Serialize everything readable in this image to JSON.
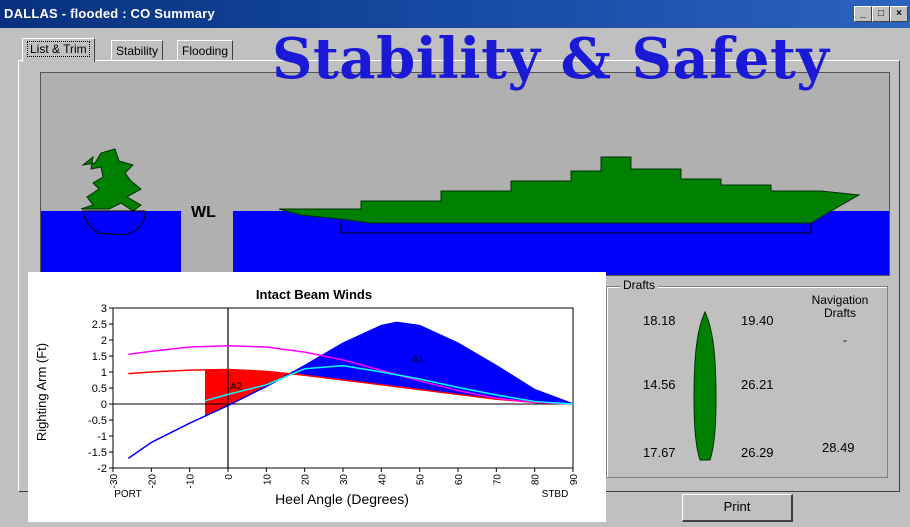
{
  "window": {
    "title": "DALLAS - flooded : CO Summary"
  },
  "titlebar_buttons": {
    "minimize": "_",
    "maximize": "□",
    "close": "×"
  },
  "tabs": [
    {
      "label": "List & Trim",
      "active": true
    },
    {
      "label": "Stability",
      "active": false
    },
    {
      "label": "Flooding",
      "active": false
    }
  ],
  "overlay_title": "Stability & Safety",
  "scene": {
    "wl_label": "WL",
    "water_color": "#0000ff",
    "hull_color": "#008000"
  },
  "drafts": {
    "legend": "Drafts",
    "nav_label_line1": "Navigation",
    "nav_label_line2": "Drafts",
    "nav_fwd": "-",
    "rows": [
      {
        "left": "18.18",
        "right": "19.40"
      },
      {
        "left": "14.56",
        "right": "26.21"
      },
      {
        "left": "17.67",
        "right": "26.29",
        "nav": "28.49"
      }
    ]
  },
  "print_label": "Print",
  "chart_data": {
    "type": "line",
    "title": "Intact Beam Winds",
    "xlabel": "Heel Angle (Degrees)",
    "ylabel": "Righting Arm (Ft)",
    "xlim": [
      -30,
      90
    ],
    "ylim": [
      -2,
      3
    ],
    "xticks": [
      -30,
      -20,
      -10,
      0,
      10,
      20,
      30,
      40,
      50,
      60,
      70,
      80,
      90
    ],
    "yticks": [
      3,
      2.5,
      2,
      1.5,
      1,
      0.5,
      0,
      -0.5,
      -1,
      -1.5,
      -2
    ],
    "x_end_labels": {
      "left": "PORT",
      "right": "STBD"
    },
    "area_labels": {
      "a2": "A2",
      "a1": "A1"
    },
    "series": [
      {
        "color": "#0000ff",
        "x": [
          -26,
          -20,
          -10,
          0,
          10,
          20,
          30,
          40,
          44,
          50,
          60,
          70,
          80,
          90
        ],
        "y": [
          -1.7,
          -1.2,
          -0.6,
          -0.05,
          0.55,
          1.2,
          1.9,
          2.45,
          2.55,
          2.45,
          1.9,
          1.2,
          0.45,
          0
        ]
      },
      {
        "color": "#ff0000",
        "x": [
          -26,
          -20,
          -10,
          0,
          10,
          20,
          30,
          40,
          50,
          60,
          70,
          80,
          90
        ],
        "y": [
          0.95,
          1.0,
          1.06,
          1.08,
          1.02,
          0.9,
          0.75,
          0.6,
          0.45,
          0.3,
          0.15,
          0.05,
          0
        ]
      },
      {
        "color": "#ff00ff",
        "x": [
          -26,
          -20,
          -10,
          0,
          10,
          20,
          30,
          40,
          50,
          60,
          70,
          80,
          90
        ],
        "y": [
          1.55,
          1.65,
          1.78,
          1.82,
          1.78,
          1.62,
          1.38,
          1.05,
          0.72,
          0.42,
          0.18,
          0.05,
          0
        ]
      },
      {
        "color": "#00ffff",
        "x": [
          -6,
          0,
          10,
          20,
          30,
          40,
          50,
          60,
          70,
          80,
          90
        ],
        "y": [
          0.1,
          0.3,
          0.6,
          1.1,
          1.2,
          1.0,
          0.78,
          0.52,
          0.28,
          0.08,
          0
        ]
      }
    ]
  }
}
